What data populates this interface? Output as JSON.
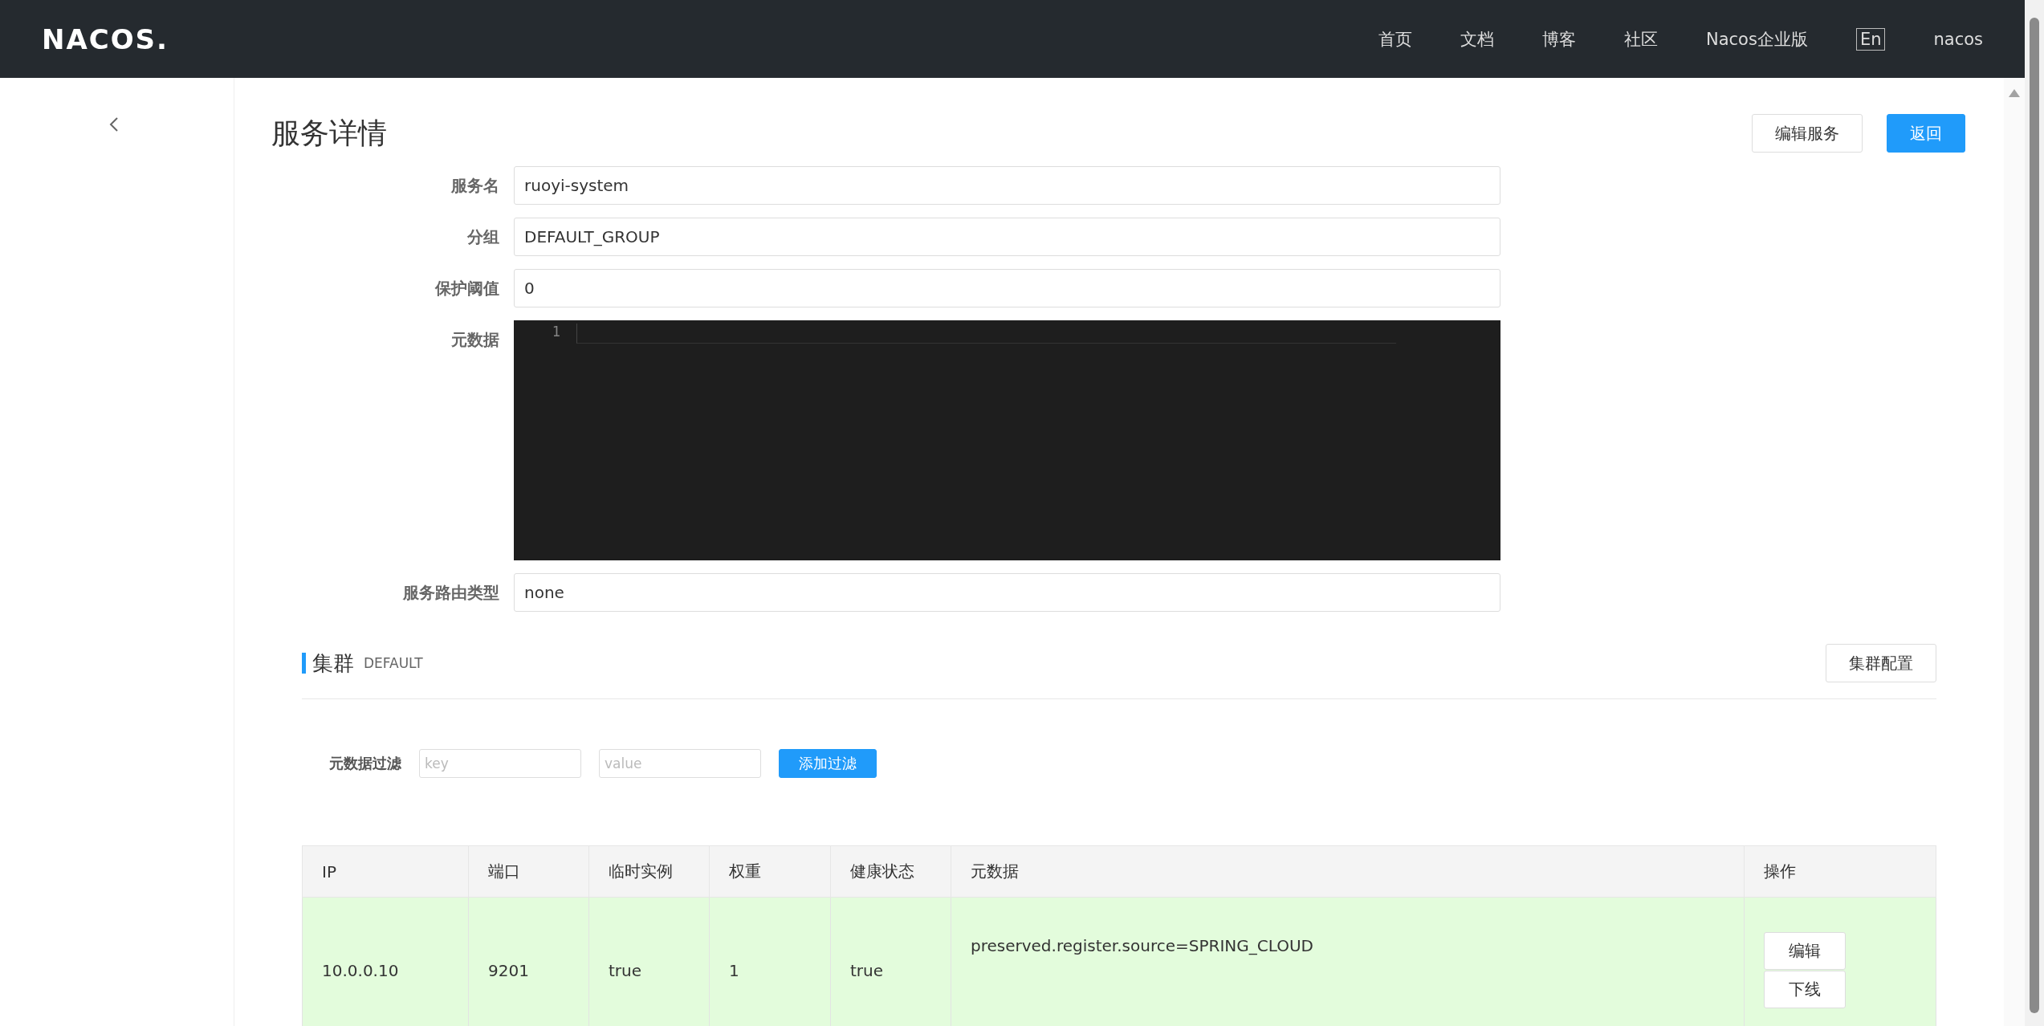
{
  "header": {
    "logo": "NACOS.",
    "nav": [
      {
        "label": "首页"
      },
      {
        "label": "文档"
      },
      {
        "label": "博客"
      },
      {
        "label": "社区"
      },
      {
        "label": "Nacos企业版"
      }
    ],
    "language": "En",
    "user": "nacos"
  },
  "page": {
    "title": "服务详情",
    "buttons": [
      {
        "label": "编辑服务",
        "kind": "default"
      },
      {
        "label": "返回",
        "kind": "primary"
      }
    ]
  },
  "form": {
    "fields": [
      {
        "label": "服务名",
        "kind": "input",
        "value": "ruoyi-system"
      },
      {
        "label": "分组",
        "kind": "input",
        "value": "DEFAULT_GROUP"
      },
      {
        "label": "保护阈值",
        "kind": "input",
        "value": "0"
      },
      {
        "label": "元数据",
        "kind": "editor",
        "line_numbers": [
          "1"
        ]
      },
      {
        "label": "服务路由类型",
        "kind": "input",
        "value": "none"
      }
    ]
  },
  "cluster": {
    "title": "集群",
    "name": "DEFAULT",
    "config_button": "集群配置",
    "filter": {
      "label": "元数据过滤",
      "key_placeholder": "key",
      "value_placeholder": "value",
      "button": "添加过滤"
    },
    "table": {
      "columns": [
        "IP",
        "端口",
        "临时实例",
        "权重",
        "健康状态",
        "元数据",
        "操作"
      ],
      "rows": [
        {
          "cells": [
            "10.0.0.10",
            "9201",
            "true",
            "1",
            "true",
            "preserved.register.source=SPRING_CLOUD"
          ],
          "actions": [
            "编辑",
            "下线"
          ]
        }
      ]
    }
  }
}
